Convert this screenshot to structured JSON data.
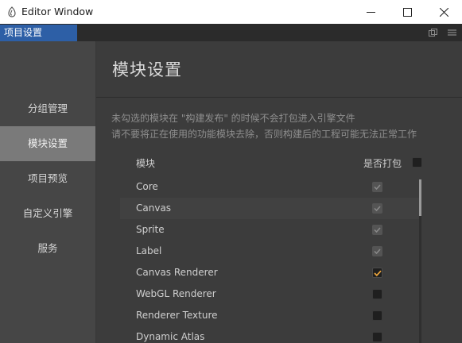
{
  "window": {
    "title": "Editor Window"
  },
  "tab": {
    "label": "项目设置"
  },
  "sidebar": {
    "items": [
      {
        "label": "分组管理",
        "active": false
      },
      {
        "label": "模块设置",
        "active": true
      },
      {
        "label": "项目预览",
        "active": false
      },
      {
        "label": "自定义引擎",
        "active": false
      },
      {
        "label": "服务",
        "active": false
      }
    ]
  },
  "main": {
    "title": "模块设置",
    "description_line1": "未勾选的模块在 \"构建发布\" 的时候不会打包进入引擎文件",
    "description_line2": "请不要将正在使用的功能模块去除，否则构建后的工程可能无法正常工作",
    "column_module": "模块",
    "column_pack": "是否打包",
    "modules": [
      {
        "name": "Core",
        "state": "checked-dim"
      },
      {
        "name": "Canvas",
        "state": "checked-dim"
      },
      {
        "name": "Sprite",
        "state": "checked-dim"
      },
      {
        "name": "Label",
        "state": "checked-dim"
      },
      {
        "name": "Canvas Renderer",
        "state": "checked-orange"
      },
      {
        "name": "WebGL Renderer",
        "state": "unchecked"
      },
      {
        "name": "Renderer Texture",
        "state": "unchecked"
      },
      {
        "name": "Dynamic Atlas",
        "state": "unchecked"
      }
    ]
  },
  "colors": {
    "accent": "#2d5fa6",
    "check_orange": "#e8a33d",
    "check_dim": "#8a8a8a"
  }
}
